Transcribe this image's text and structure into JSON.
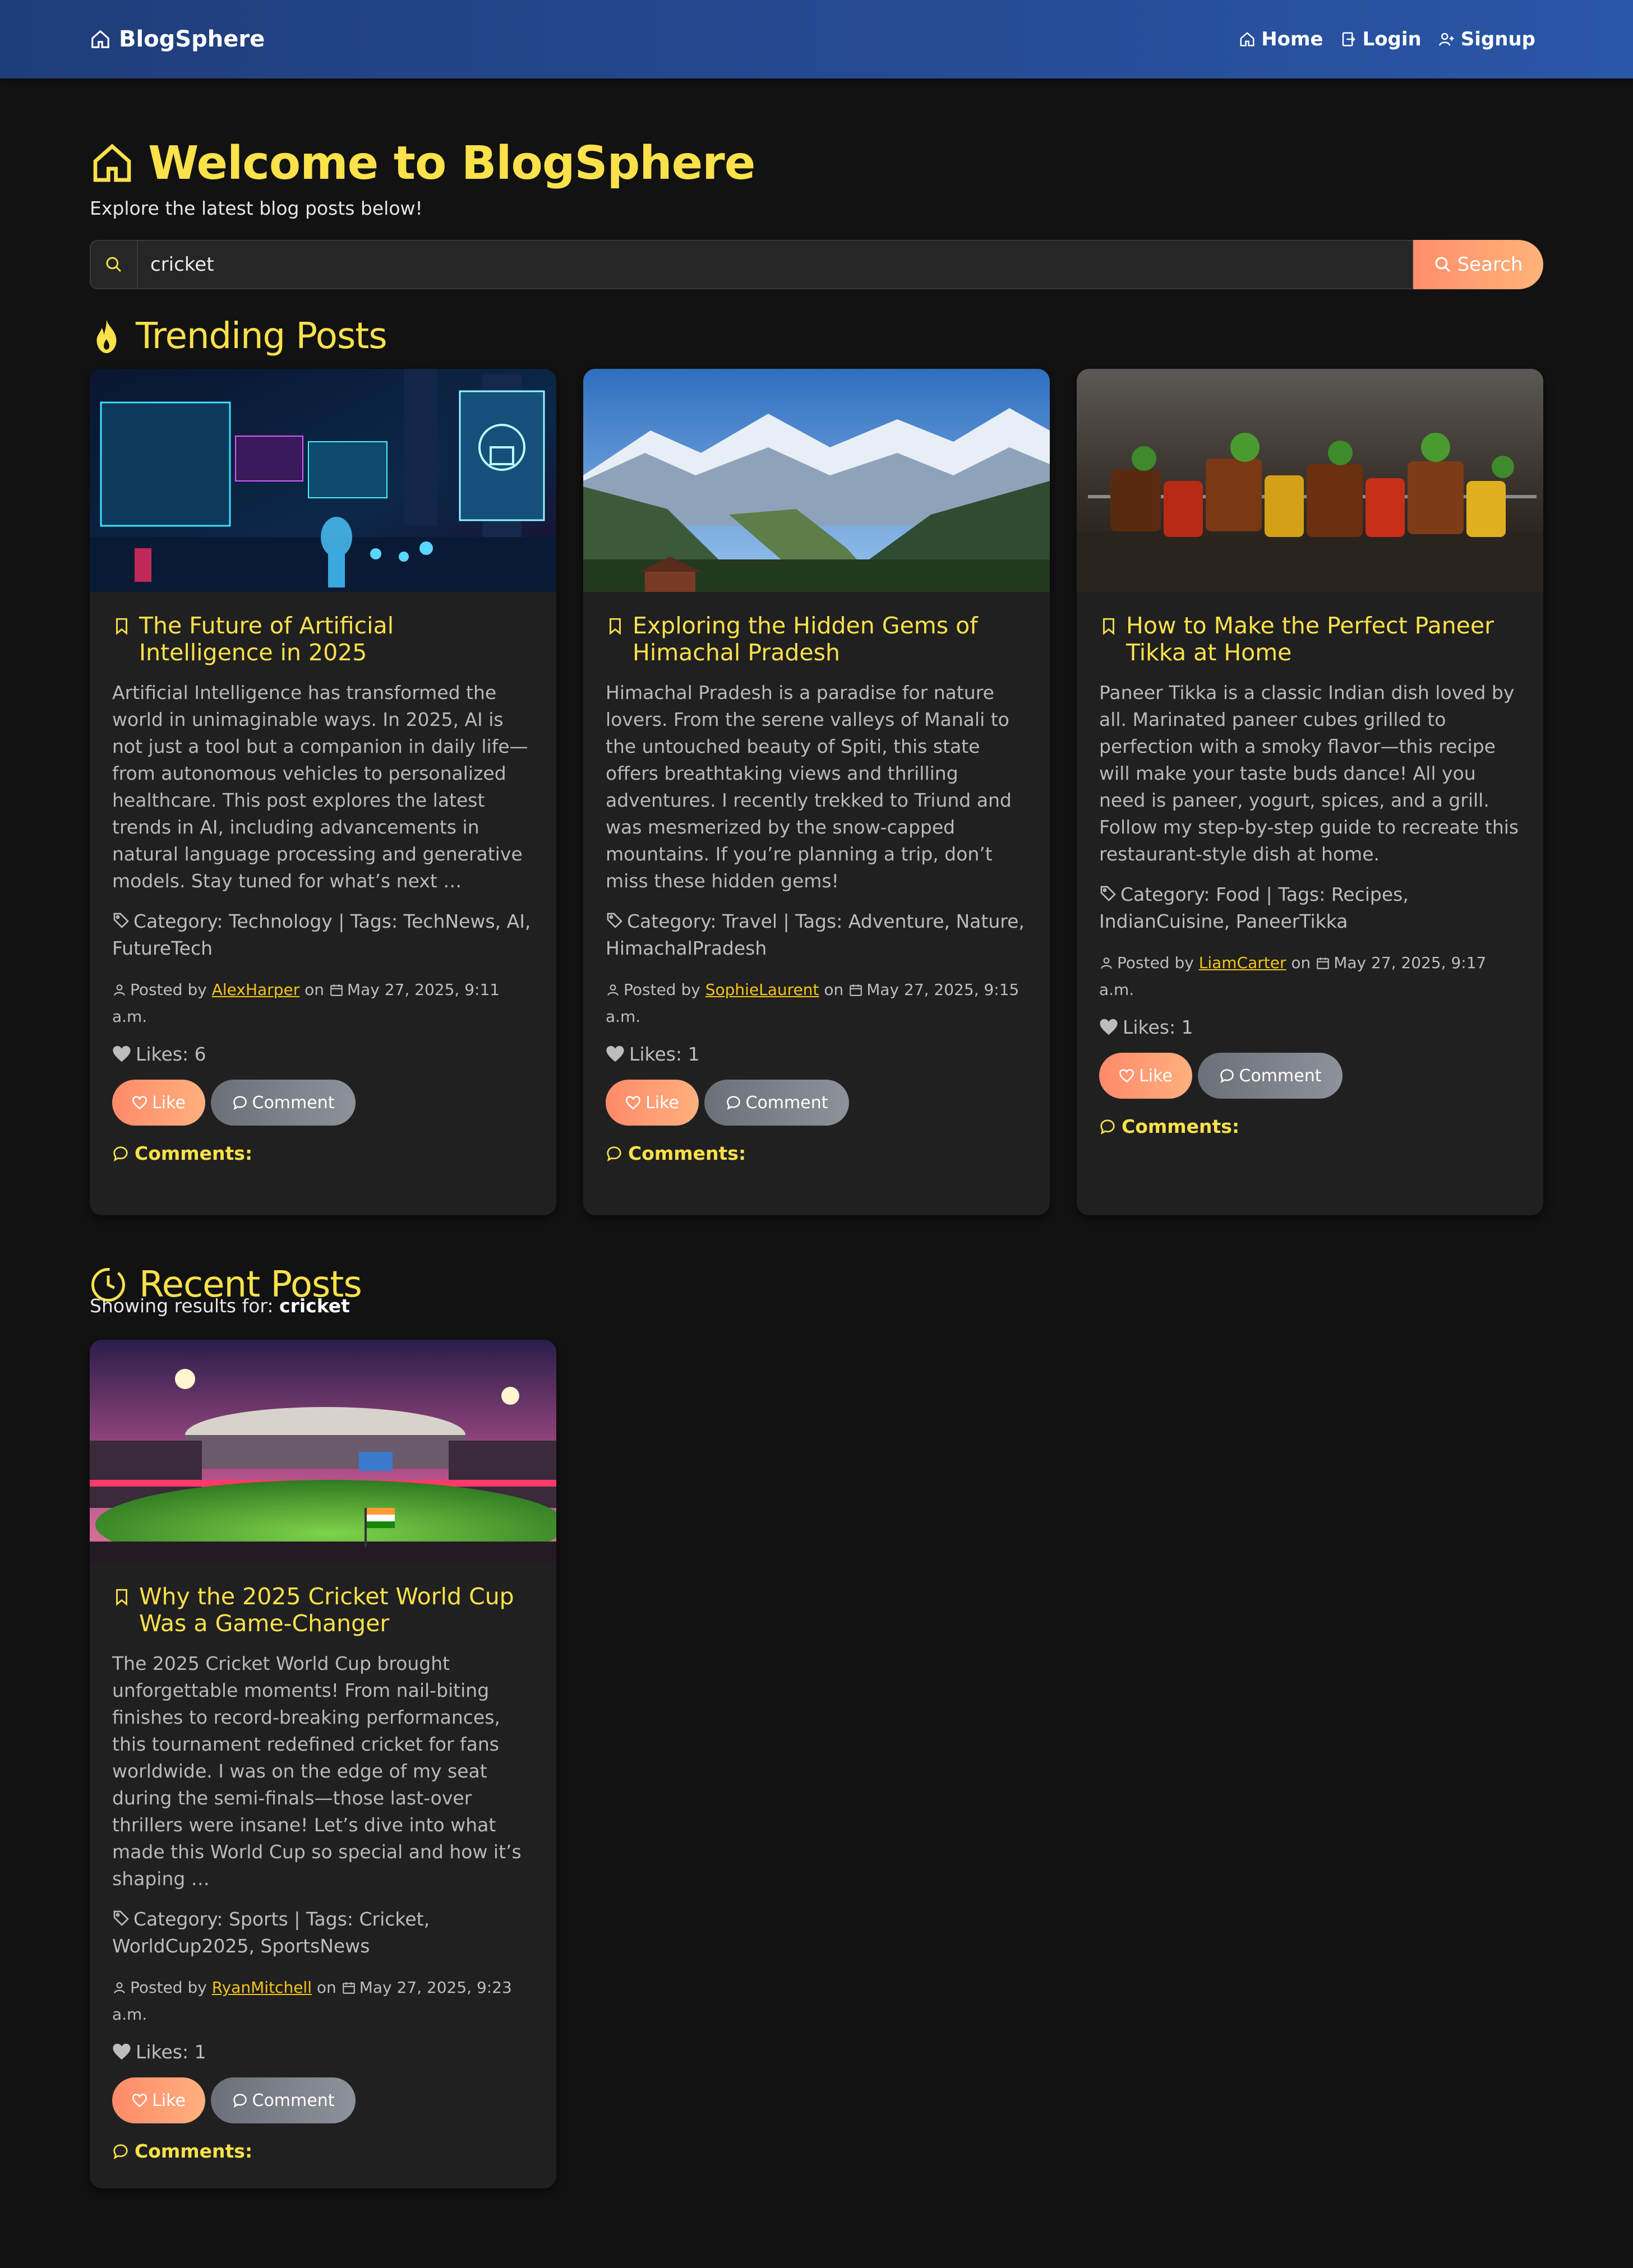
{
  "navbar": {
    "brand": "BlogSphere",
    "links": [
      {
        "label": "Home",
        "icon": "home-icon"
      },
      {
        "label": "Login",
        "icon": "login-icon"
      },
      {
        "label": "Signup",
        "icon": "user-plus-icon"
      }
    ]
  },
  "header": {
    "title": "Welcome to BlogSphere",
    "subtitle": "Explore the latest blog posts below!"
  },
  "search": {
    "value": "cricket",
    "button_label": "Search"
  },
  "trending": {
    "title": "Trending Posts",
    "posts": [
      {
        "title": "The Future of Artificial Intelligence in 2025",
        "excerpt": "Artificial Intelligence has transformed the world in unimaginable ways. In 2025, AI is not just a tool but a companion in daily life—from autonomous vehicles to personalized healthcare. This post explores the latest trends in AI, including advancements in natural language processing and generative models. Stay tuned for what’s next …",
        "meta": "Category: Technology | Tags: TechNews, AI, FutureTech",
        "posted_by": "Posted by",
        "author": "AlexHarper",
        "on": "on",
        "date": "May 27, 2025, 9:11 a.m.",
        "likes": "Likes: 6",
        "like_label": "Like",
        "comment_label": "Comment",
        "comments_heading": "Comments:"
      },
      {
        "title": "Exploring the Hidden Gems of Himachal Pradesh",
        "excerpt": "Himachal Pradesh is a paradise for nature lovers. From the serene valleys of Manali to the untouched beauty of Spiti, this state offers breathtaking views and thrilling adventures. I recently trekked to Triund and was mesmerized by the snow-capped mountains. If you’re planning a trip, don’t miss these hidden gems!",
        "meta": "Category: Travel | Tags: Adventure, Nature, HimachalPradesh",
        "posted_by": "Posted by",
        "author": "SophieLaurent",
        "on": "on",
        "date": "May 27, 2025, 9:15 a.m.",
        "likes": "Likes: 1",
        "like_label": "Like",
        "comment_label": "Comment",
        "comments_heading": "Comments:"
      },
      {
        "title": "How to Make the Perfect Paneer Tikka at Home",
        "excerpt": "Paneer Tikka is a classic Indian dish loved by all. Marinated paneer cubes grilled to perfection with a smoky flavor—this recipe will make your taste buds dance! All you need is paneer, yogurt, spices, and a grill. Follow my step-by-step guide to recreate this restaurant-style dish at home.",
        "meta": "Category: Food | Tags: Recipes, IndianCuisine, PaneerTikka",
        "posted_by": "Posted by",
        "author": "LiamCarter",
        "on": "on",
        "date": "May 27, 2025, 9:17 a.m.",
        "likes": "Likes: 1",
        "like_label": "Like",
        "comment_label": "Comment",
        "comments_heading": "Comments:"
      }
    ]
  },
  "recent": {
    "title": "Recent Posts",
    "showing_prefix": "Showing results for:",
    "query": "cricket",
    "posts": [
      {
        "title": "Why the 2025 Cricket World Cup Was a Game-Changer",
        "excerpt": "The 2025 Cricket World Cup brought unforgettable moments! From nail-biting finishes to record-breaking performances, this tournament redefined cricket for fans worldwide. I was on the edge of my seat during the semi-finals—those last-over thrillers were insane! Let’s dive into what made this World Cup so special and how it’s shaping …",
        "meta": "Category: Sports | Tags: Cricket, WorldCup2025, SportsNews",
        "posted_by": "Posted by",
        "author": "RyanMitchell",
        "on": "on",
        "date": "May 27, 2025, 9:23 a.m.",
        "likes": "Likes: 1",
        "like_label": "Like",
        "comment_label": "Comment",
        "comments_heading": "Comments:"
      }
    ]
  },
  "colors": {
    "background": "#121212",
    "navbar_start": "#1f3d7a",
    "navbar_end": "#2a56a8",
    "accent_yellow": "#fbe14a",
    "like_button": "#ff8a6a",
    "comment_button": "#7a7e86",
    "card": "#202020"
  }
}
